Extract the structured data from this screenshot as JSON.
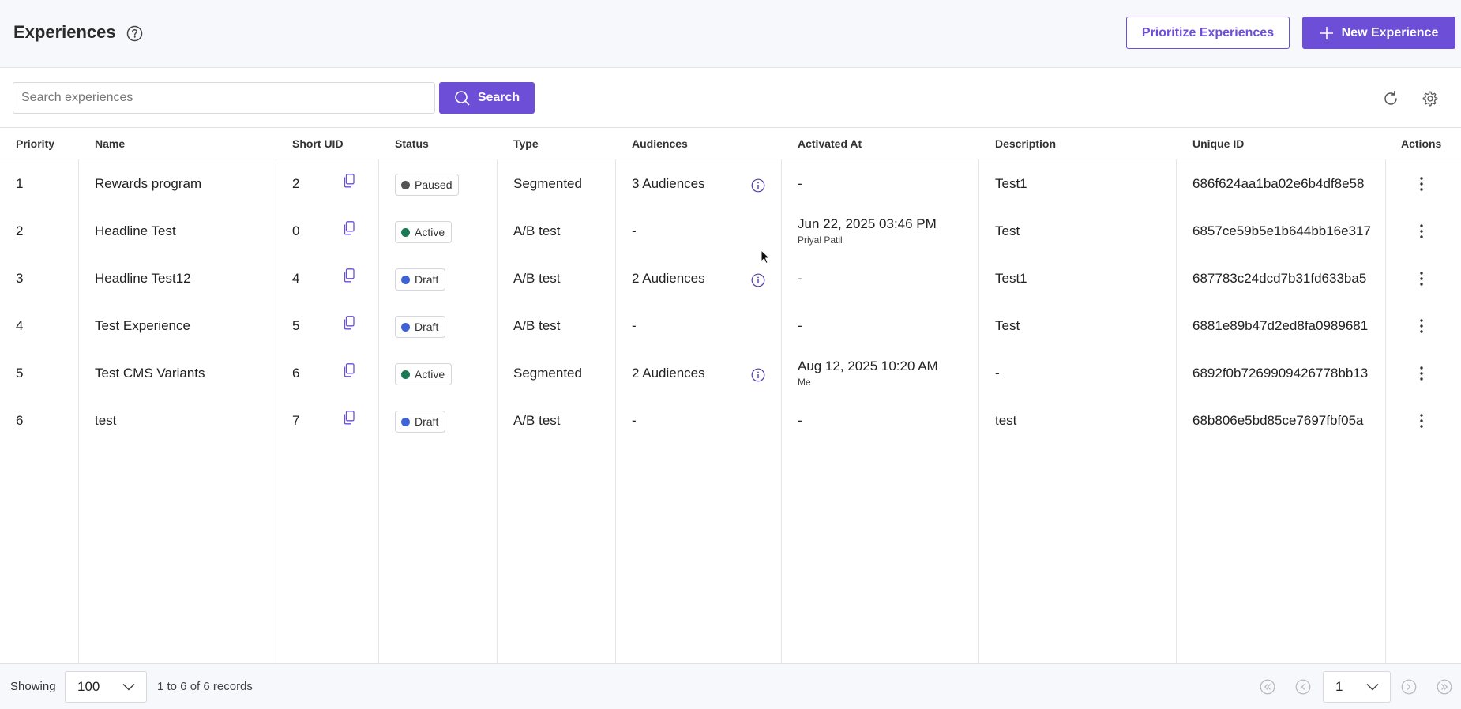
{
  "header": {
    "title": "Experiences",
    "prioritize_label": "Prioritize Experiences",
    "new_label": "New Experience"
  },
  "search": {
    "placeholder": "Search experiences",
    "value": "",
    "button_label": "Search"
  },
  "table": {
    "columns": [
      "Priority",
      "Name",
      "Short UID",
      "Status",
      "Type",
      "Audiences",
      "Activated At",
      "Description",
      "Unique ID",
      "Actions"
    ],
    "rows": [
      {
        "priority": "1",
        "name": "Rewards program",
        "short_uid": "2",
        "status": "Paused",
        "type": "Segmented",
        "audiences": "3 Audiences",
        "activated_at": "-",
        "activated_by": "",
        "description": "Test1",
        "unique_id": "686f624aa1ba02e6b4df8e58"
      },
      {
        "priority": "2",
        "name": "Headline Test",
        "short_uid": "0",
        "status": "Active",
        "type": "A/B test",
        "audiences": "-",
        "activated_at": "Jun 22, 2025 03:46 PM",
        "activated_by": "Priyal Patil",
        "description": "Test",
        "unique_id": "6857ce59b5e1b644bb16e317"
      },
      {
        "priority": "3",
        "name": "Headline Test12",
        "short_uid": "4",
        "status": "Draft",
        "type": "A/B test",
        "audiences": "2 Audiences",
        "activated_at": "-",
        "activated_by": "",
        "description": "Test1",
        "unique_id": "687783c24dcd7b31fd633ba5"
      },
      {
        "priority": "4",
        "name": "Test Experience",
        "short_uid": "5",
        "status": "Draft",
        "type": "A/B test",
        "audiences": "-",
        "activated_at": "-",
        "activated_by": "",
        "description": "Test",
        "unique_id": "6881e89b47d2ed8fa0989681"
      },
      {
        "priority": "5",
        "name": "Test CMS Variants",
        "short_uid": "6",
        "status": "Active",
        "type": "Segmented",
        "audiences": "2 Audiences",
        "activated_at": "Aug 12, 2025 10:20 AM",
        "activated_by": "Me",
        "description": "-",
        "unique_id": "6892f0b7269909426778bb13"
      },
      {
        "priority": "6",
        "name": "test",
        "short_uid": "7",
        "status": "Draft",
        "type": "A/B test",
        "audiences": "-",
        "activated_at": "-",
        "activated_by": "",
        "description": "test",
        "unique_id": "68b806e5bd85ce7697fbf05a"
      }
    ]
  },
  "status_colors": {
    "Paused": "#555555",
    "Active": "#1a7a55",
    "Draft": "#3f62d6"
  },
  "footer": {
    "showing_label": "Showing",
    "page_size": "100",
    "records_text": "1 to 6 of 6 records",
    "current_page": "1"
  },
  "colors": {
    "accent": "#6c4fd6"
  }
}
